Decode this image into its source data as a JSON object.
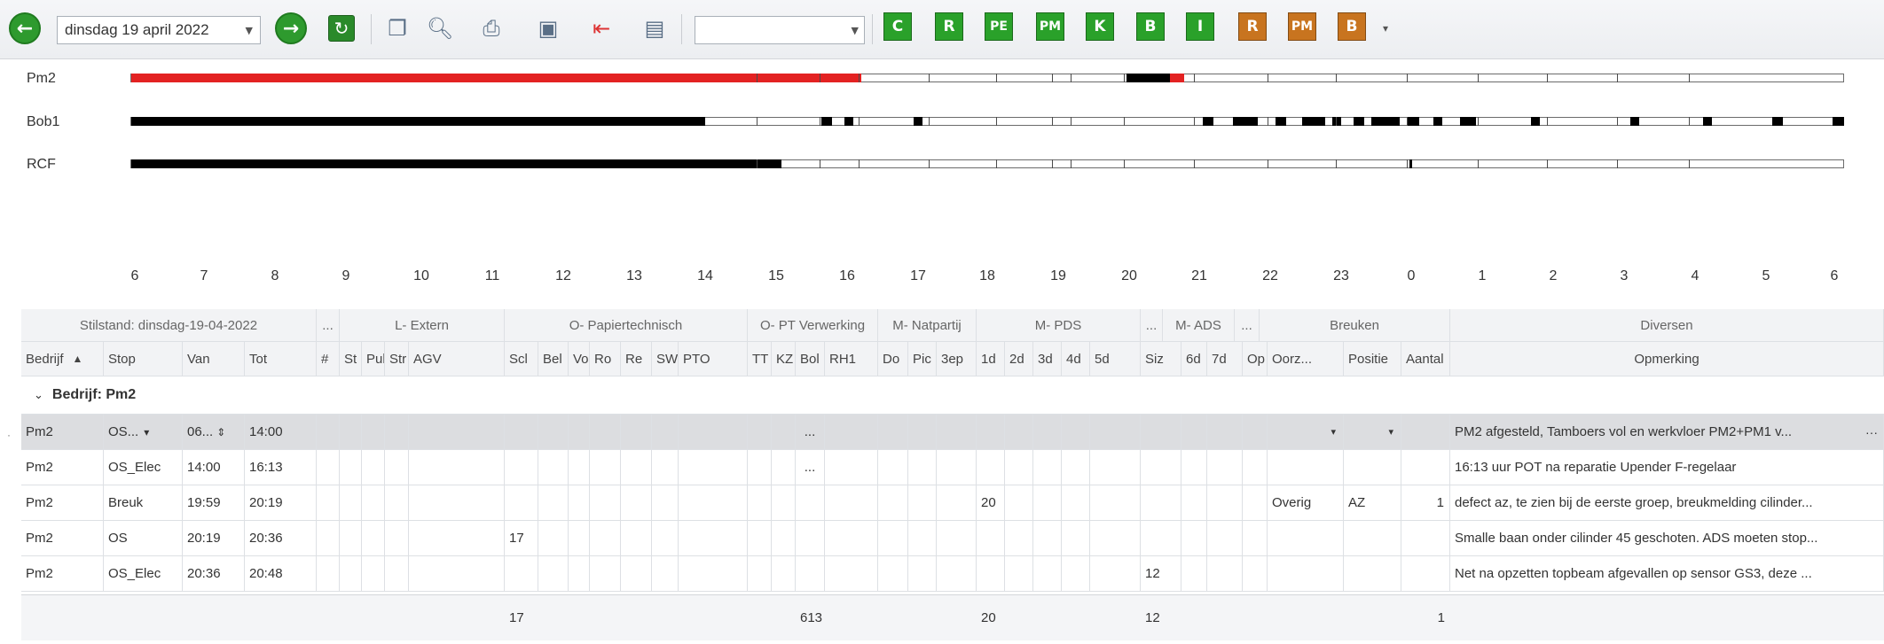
{
  "toolbar": {
    "date_value": "dinsdag 19 april 2022",
    "filter_value": "",
    "letter_buttons": [
      {
        "label": "C",
        "color": "green"
      },
      {
        "label": "R",
        "color": "green"
      },
      {
        "label": "PE",
        "color": "green"
      },
      {
        "label": "PM",
        "color": "green"
      },
      {
        "label": "K",
        "color": "green"
      },
      {
        "label": "B",
        "color": "green"
      },
      {
        "label": "I",
        "color": "green"
      },
      {
        "label": "R",
        "color": "brown"
      },
      {
        "label": "PM",
        "color": "brown"
      },
      {
        "label": "B",
        "color": "brown"
      }
    ]
  },
  "timeline": {
    "rows": [
      "Pm2",
      "Bob1",
      "RCF"
    ],
    "hours": [
      "6",
      "7",
      "8",
      "9",
      "10",
      "11",
      "12",
      "13",
      "14",
      "15",
      "16",
      "17",
      "18",
      "19",
      "20",
      "21",
      "22",
      "23",
      "0",
      "1",
      "2",
      "3",
      "4",
      "5",
      "6"
    ]
  },
  "grid": {
    "bands": [
      "Stilstand: dinsdag-19-04-2022",
      "...",
      "L- Extern",
      "O- Papiertechnisch",
      "O- PT Verwerking",
      "M- Natpartij",
      "M- PDS",
      "...",
      "M- ADS",
      "...",
      "Breuken",
      "Diversen"
    ],
    "columns": [
      "Bedrijf",
      "Stop",
      "Van",
      "Tot",
      "#",
      "St",
      "Pul",
      "Str",
      "AGV",
      "Scl",
      "Bel",
      "Vo",
      "Ro",
      "Re",
      "SW",
      "PTO",
      "TT",
      "KZ",
      "Bol",
      "RH1",
      "Do",
      "Pic",
      "3ep",
      "1d",
      "2d",
      "3d",
      "4d",
      "5d",
      "Siz",
      "6d",
      "7d",
      "Op",
      "Oorz...",
      "Positie",
      "Aantal",
      "Opmerking"
    ],
    "sort_indicator": "▲",
    "group_label": "Bedrijf: Pm2",
    "rows": [
      {
        "bedrijf": "Pm2",
        "stop": "OS...",
        "van": "06...",
        "tot": "14:00",
        "bol": "...",
        "oorzaak": "",
        "positie": "",
        "aantal": "",
        "scl": "",
        "d1": "",
        "siz": "",
        "opmerking": "PM2 afgesteld, Tamboers vol en werkvloer PM2+PM1 v..."
      },
      {
        "bedrijf": "Pm2",
        "stop": "OS_Elec",
        "van": "14:00",
        "tot": "16:13",
        "bol": "...",
        "oorzaak": "",
        "positie": "",
        "aantal": "",
        "scl": "",
        "d1": "",
        "siz": "",
        "opmerking": "16:13 uur POT na reparatie Upender F-regelaar"
      },
      {
        "bedrijf": "Pm2",
        "stop": "Breuk",
        "van": "19:59",
        "tot": "20:19",
        "bol": "",
        "oorzaak": "Overig",
        "positie": "AZ",
        "aantal": "1",
        "scl": "",
        "d1": "20",
        "siz": "",
        "opmerking": "defect az, te zien bij de eerste groep, breukmelding cilinder..."
      },
      {
        "bedrijf": "Pm2",
        "stop": "OS",
        "van": "20:19",
        "tot": "20:36",
        "bol": "",
        "oorzaak": "",
        "positie": "",
        "aantal": "",
        "scl": "17",
        "d1": "",
        "siz": "",
        "opmerking": "Smalle baan onder cilinder 45 geschoten. ADS moeten stop..."
      },
      {
        "bedrijf": "Pm2",
        "stop": "OS_Elec",
        "van": "20:36",
        "tot": "20:48",
        "bol": "",
        "oorzaak": "",
        "positie": "",
        "aantal": "",
        "scl": "",
        "d1": "",
        "siz": "12",
        "opmerking": "Net na opzetten topbeam afgevallen op sensor GS3, deze ..."
      }
    ],
    "totals": {
      "scl": "17",
      "bol": "613",
      "d1": "20",
      "siz": "12",
      "aantal": "1"
    }
  }
}
